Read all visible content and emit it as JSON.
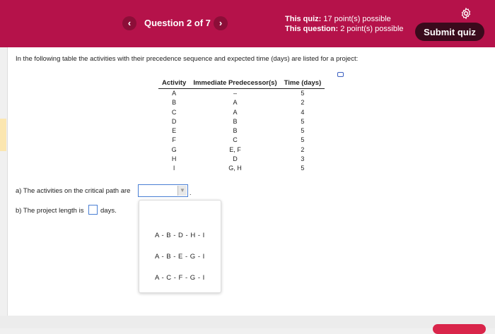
{
  "header": {
    "question_label": "Question 2 of 7",
    "prev_icon": "chevron-left-icon",
    "next_icon": "chevron-right-icon",
    "quiz_points_label": "This quiz:",
    "quiz_points_value": "17 point(s) possible",
    "question_points_label": "This question:",
    "question_points_value": "2 point(s) possible",
    "submit_label": "Submit quiz",
    "settings_icon": "gear-icon",
    "accent_color": "#b5124a"
  },
  "intro": "In the following table the activities with their precedence sequence and expected time (days) are listed for a project:",
  "table": {
    "headers": [
      "Activity",
      "Immediate Predecessor(s)",
      "Time (days)"
    ],
    "rows": [
      [
        "A",
        "–",
        "5"
      ],
      [
        "B",
        "A",
        "2"
      ],
      [
        "C",
        "A",
        "4"
      ],
      [
        "D",
        "B",
        "5"
      ],
      [
        "E",
        "B",
        "5"
      ],
      [
        "F",
        "C",
        "5"
      ],
      [
        "G",
        "E, F",
        "2"
      ],
      [
        "H",
        "D",
        "3"
      ],
      [
        "I",
        "G, H",
        "5"
      ]
    ]
  },
  "question_a": "a) The activities on the critical path are",
  "question_b": "b) The project length is",
  "days_label": "days.",
  "dot": ".",
  "dropdown_options": [
    "A - B - D - H - I",
    "A - B - E - G - I",
    "A - C - F - G - I"
  ]
}
